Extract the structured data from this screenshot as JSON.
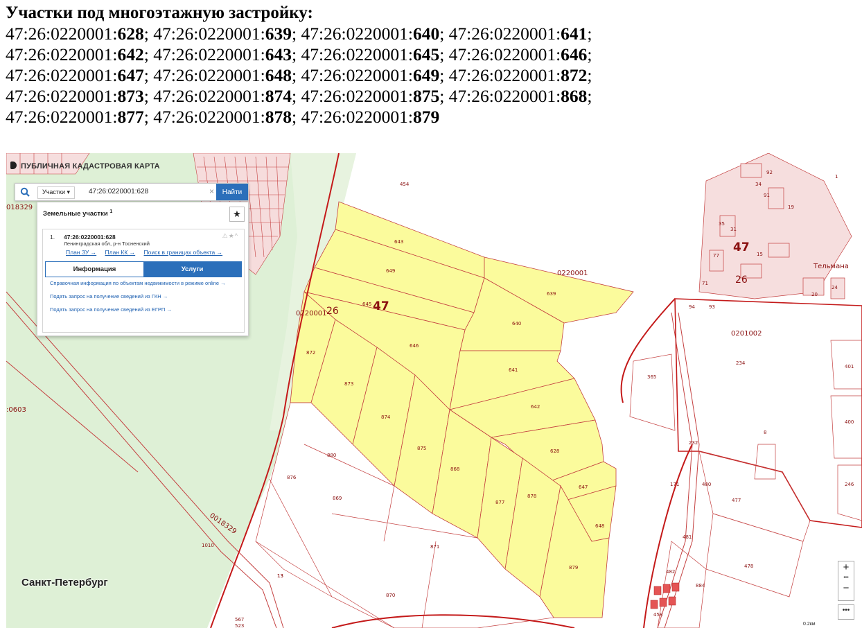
{
  "header": {
    "title": "Участки под многоэтажную застройку:",
    "prefix": "47:26:0220001:",
    "lines": [
      {
        "parts": [
          "47:26:0220001:",
          "628",
          ";  47:26:0220001:",
          "639",
          "; 47:26:0220001:",
          "640",
          "; 47:26:0220001:",
          "641",
          ";"
        ]
      },
      {
        "parts": [
          "47:26:0220001:",
          "642",
          ";  47:26:0220001:",
          "643",
          "; 47:26:0220001:",
          "645",
          "; 47:26:0220001:",
          "646",
          ";"
        ]
      },
      {
        "parts": [
          "47:26:0220001:",
          "647",
          ";  47:26:0220001:",
          "648",
          "; 47:26:0220001:",
          "649",
          "; 47:26:0220001:",
          "872",
          ";"
        ]
      },
      {
        "parts": [
          "47:26:0220001:",
          "873",
          "; 47:26:0220001:",
          "874",
          "; 47:26:0220001:",
          "875",
          "; 47:26:0220001:",
          "868",
          ";"
        ]
      },
      {
        "parts": [
          "47:26:0220001:",
          "877",
          "; 47:26:0220001:",
          "878",
          "; 47:26:0220001:",
          "879",
          ""
        ]
      }
    ]
  },
  "map_ui": {
    "brand": "ПУБЛИЧНАЯ КАДАСТРОВАЯ КАРТА",
    "search_dropdown": "Участки ▾",
    "search_value": "47:26:0220001:628",
    "clear_icon": "×",
    "find_label": "Найти",
    "panel_title": "Земельные участки",
    "panel_count": "1",
    "star_icon": "★",
    "result_index": "1.",
    "result_cad": "47:26:0220001:628",
    "result_address": "Ленинградская обл, р-н Тосненский",
    "result_icons": "⚠★^",
    "links": [
      "План ЗУ →",
      "План КК →",
      "Поиск в границах объекта →"
    ],
    "tab_info": "Информация",
    "tab_services": "Услуги",
    "service_links": [
      "Справочная информация по объектам недвижимости в режиме online →",
      "Подать запрос на получение сведений из ГКН →",
      "Подать запрос на получение сведений из ЕГРП →"
    ],
    "city_label": "Санкт-Петербург",
    "zoom_in": "+",
    "zoom_out": "−",
    "more": "•••",
    "scale": "0.2км"
  },
  "map_labels": {
    "quarter_main": "0220001",
    "quarter_east": "0201002",
    "quarter_road": "0018329",
    "region": "47",
    "district": "26",
    "settlement": "Тельмана",
    "edge_left_1": "018329",
    "edge_left_2": ":0603",
    "highlighted_plots": [
      "643",
      "649",
      "645",
      "639",
      "640",
      "646",
      "641",
      "642",
      "628",
      "647",
      "648",
      "872",
      "873",
      "874",
      "875",
      "868",
      "877",
      "878",
      "879"
    ],
    "plots_shown": [
      "454",
      "643",
      "649",
      "645",
      "639",
      "640",
      "646",
      "641",
      "642",
      "628",
      "647",
      "648",
      "872",
      "873",
      "874",
      "875",
      "868",
      "877",
      "878",
      "879",
      "880",
      "876",
      "869",
      "871",
      "870",
      "365",
      "234",
      "401",
      "400",
      "246",
      "8",
      "232",
      "480",
      "477",
      "481",
      "478",
      "482",
      "884",
      "94",
      "93",
      "20",
      "171",
      "1010",
      "13",
      "567",
      "523",
      "458",
      "1",
      "92",
      "91",
      "34",
      "19",
      "31",
      "35",
      "71",
      "77",
      "15",
      "13",
      "24"
    ]
  },
  "colors": {
    "highlight_fill": "#fbfb9c",
    "boundary": "#c41a1a",
    "plot_line": "#c44040",
    "forest": "#def0d6",
    "button_blue": "#2b6fba"
  }
}
